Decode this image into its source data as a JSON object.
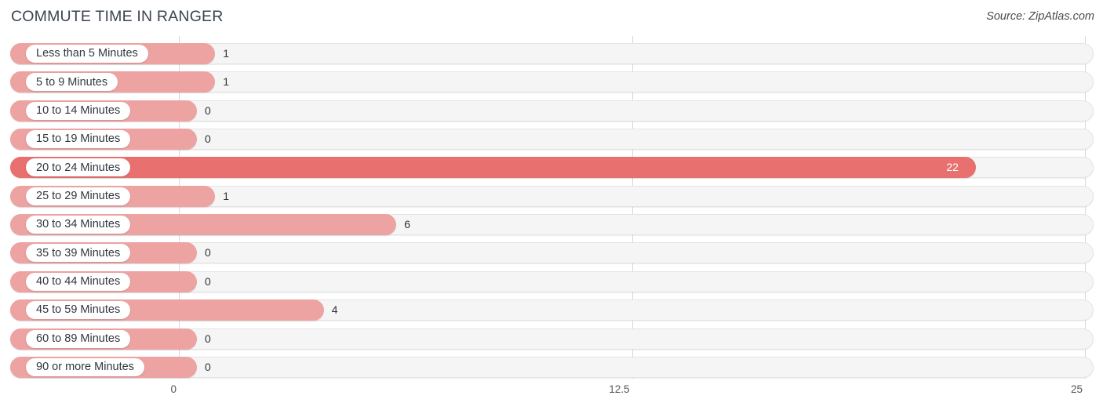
{
  "header": {
    "title": "COMMUTE TIME IN RANGER",
    "source": "Source: ZipAtlas.com",
    "watermark": ""
  },
  "axis": {
    "ticks": [
      "0",
      "12.5",
      "25"
    ]
  },
  "chart_data": {
    "type": "bar",
    "orientation": "horizontal",
    "title": "COMMUTE TIME IN RANGER",
    "source": "Source: ZipAtlas.com",
    "xlabel": "",
    "ylabel": "",
    "xlim": [
      0,
      25
    ],
    "xticks": [
      0,
      12.5,
      25
    ],
    "grid": true,
    "legend": false,
    "categories": [
      "Less than 5 Minutes",
      "5 to 9 Minutes",
      "10 to 14 Minutes",
      "15 to 19 Minutes",
      "20 to 24 Minutes",
      "25 to 29 Minutes",
      "30 to 34 Minutes",
      "35 to 39 Minutes",
      "40 to 44 Minutes",
      "45 to 59 Minutes",
      "60 to 89 Minutes",
      "90 or more Minutes"
    ],
    "values": [
      1,
      1,
      0,
      0,
      22,
      1,
      6,
      0,
      0,
      4,
      0,
      0
    ],
    "value_labels": [
      "1",
      "1",
      "0",
      "0",
      "22",
      "1",
      "6",
      "0",
      "0",
      "4",
      "0",
      "0"
    ],
    "colors": {
      "bar": "#eda3a2",
      "bar_highlight": "#e8706e",
      "track": "#f5f5f5",
      "track_border": "#e4e4e4",
      "gridline": "#d8d8d8",
      "label_text": "#31383f",
      "title_text": "#3c4450"
    },
    "highlight_index": 4
  },
  "rows": [
    {
      "label": "Less than 5 Minutes",
      "value": "1",
      "v": 1,
      "highlight": false
    },
    {
      "label": "5 to 9 Minutes",
      "value": "1",
      "v": 1,
      "highlight": false
    },
    {
      "label": "10 to 14 Minutes",
      "value": "0",
      "v": 0,
      "highlight": false
    },
    {
      "label": "15 to 19 Minutes",
      "value": "0",
      "v": 0,
      "highlight": false
    },
    {
      "label": "20 to 24 Minutes",
      "value": "22",
      "v": 22,
      "highlight": true
    },
    {
      "label": "25 to 29 Minutes",
      "value": "1",
      "v": 1,
      "highlight": false
    },
    {
      "label": "30 to 34 Minutes",
      "value": "6",
      "v": 6,
      "highlight": false
    },
    {
      "label": "35 to 39 Minutes",
      "value": "0",
      "v": 0,
      "highlight": false
    },
    {
      "label": "40 to 44 Minutes",
      "value": "0",
      "v": 0,
      "highlight": false
    },
    {
      "label": "45 to 59 Minutes",
      "value": "4",
      "v": 4,
      "highlight": false
    },
    {
      "label": "60 to 89 Minutes",
      "value": "0",
      "v": 0,
      "highlight": false
    },
    {
      "label": "90 or more Minutes",
      "value": "0",
      "v": 0,
      "highlight": false
    }
  ]
}
